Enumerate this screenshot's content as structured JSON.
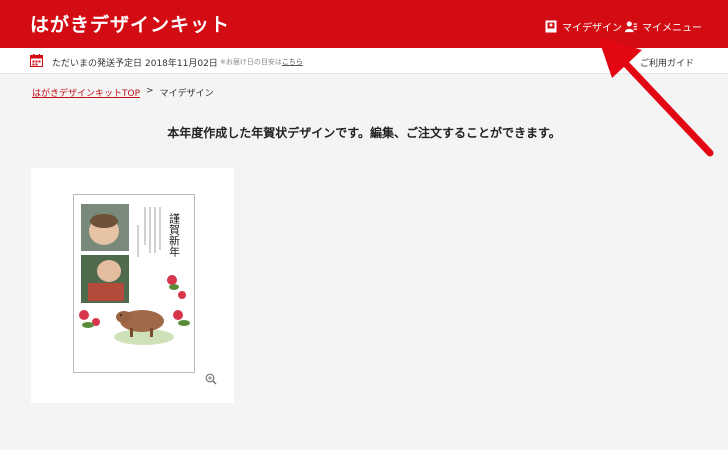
{
  "header": {
    "logo": "はがきデザインキット",
    "my_design": "マイデザイン",
    "my_menu": "マイメニュー"
  },
  "infobar": {
    "shipping_label": "ただいまの発送予定日",
    "shipping_date": "2018年11月02日",
    "note_prefix": "※お届け日の目安は",
    "note_link": "こちら",
    "guide": "ご利用ガイド"
  },
  "breadcrumb": {
    "home": "はがきデザインキットTOP",
    "separator": ">",
    "current": "マイデザイン"
  },
  "main": {
    "message": "本年度作成した年賀状デザインです。編集、ご注文することができます。"
  },
  "card": {
    "greeting": "謹賀新年"
  },
  "colors": {
    "brand_red": "#d30c14",
    "arrow_red": "#e30613"
  }
}
